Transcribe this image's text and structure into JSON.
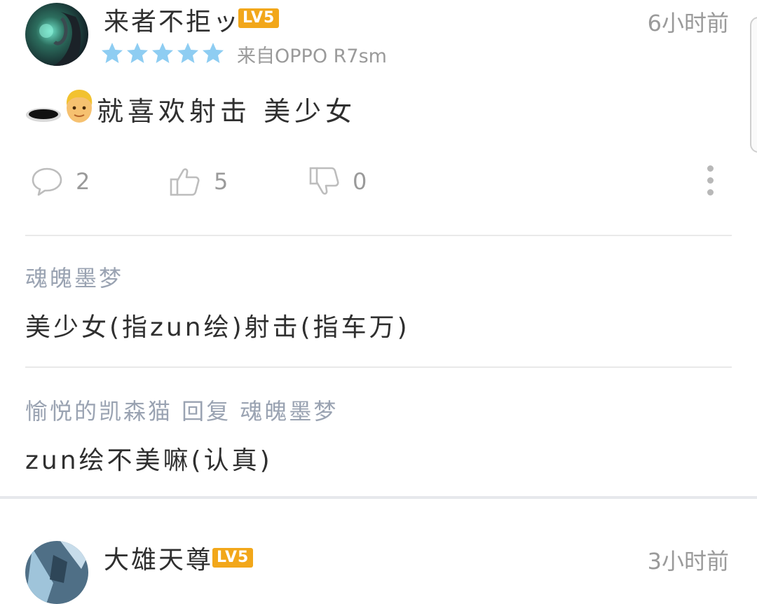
{
  "post": {
    "username": "来者不拒ッ",
    "level": "LV5",
    "time": "6小时前",
    "rating_stars": 5,
    "device": "来自OPPO R7sm",
    "content": "就喜欢射击 美少女",
    "actions": {
      "comments": "2",
      "likes": "5",
      "dislikes": "0"
    }
  },
  "replies": [
    {
      "author": "魂魄墨梦",
      "text": "美少女(指zun绘)射击(指车万)"
    },
    {
      "author": "愉悦的凯森猫 回复 魂魄墨梦",
      "text": "zun绘不美嘛(认真)"
    }
  ],
  "next_post": {
    "username": "大雄天尊",
    "level": "LV5",
    "time": "3小时前"
  },
  "colors": {
    "star": "#8ecdf2",
    "badge": "#f2a71a",
    "reply_author": "#9aa3b2",
    "meta_gray": "#9a9a9a"
  },
  "icons": {
    "comment": "speech-bubble-icon",
    "like": "thumbs-up-icon",
    "dislike": "thumbs-down-icon",
    "more": "vertical-ellipsis-icon"
  }
}
